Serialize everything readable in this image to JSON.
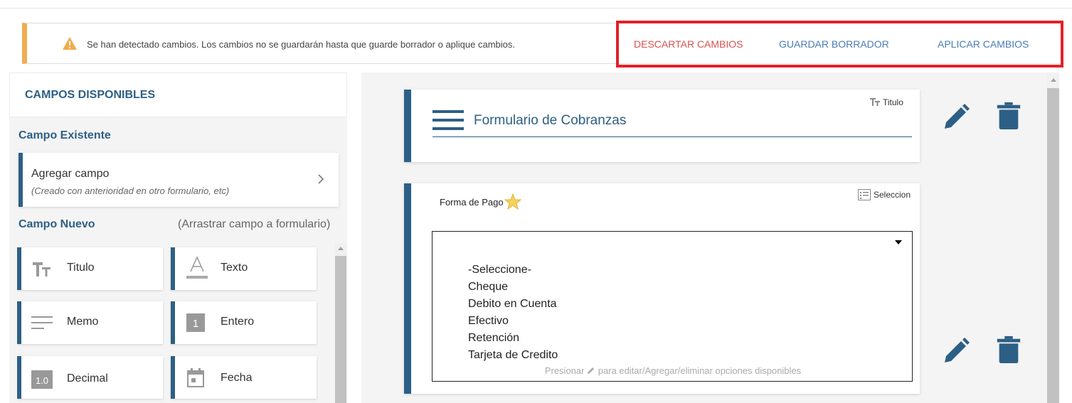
{
  "banner": {
    "message": "Se han detectado cambios. Los cambios no se guardarán hasta que guarde borrador o aplique cambios.",
    "discard": "DESCARTAR CAMBIOS",
    "save_draft": "GUARDAR BORRADOR",
    "apply": "APLICAR CAMBIOS"
  },
  "left_panel": {
    "title": "CAMPOS DISPONIBLES",
    "existing_section": "Campo Existente",
    "add_field": {
      "title": "Agregar campo",
      "subtitle": "(Creado con anterioridad en otro formulario, etc)"
    },
    "new_section": "Campo Nuevo",
    "drag_hint": "(Arrastrar campo a formulario)",
    "tiles": [
      {
        "label": "Titulo",
        "icon": "title-icon"
      },
      {
        "label": "Texto",
        "icon": "text-icon"
      },
      {
        "label": "Memo",
        "icon": "memo-icon"
      },
      {
        "label": "Entero",
        "icon": "integer-icon",
        "icon_text": "1"
      },
      {
        "label": "Decimal",
        "icon": "decimal-icon",
        "icon_text": "1.0"
      },
      {
        "label": "Fecha",
        "icon": "calendar-icon"
      }
    ]
  },
  "form": {
    "title_field": {
      "type_label": "Titulo",
      "value": "Formulario de Cobranzas"
    },
    "select_field": {
      "type_label": "Seleccion",
      "label": "Forma de Pago",
      "options": [
        "-Seleccione-",
        "Cheque",
        "Debito en Cuenta",
        "Efectivo",
        "Retención",
        "Tarjeta de Credito"
      ],
      "hint_before": "Presionar",
      "hint_after": "para editar/Agregar/eliminar opciones disponibles"
    }
  },
  "colors": {
    "primary": "#2d5f86",
    "warning": "#f0ad4e",
    "danger": "#d9534f",
    "link": "#4a7cb8",
    "highlight": "#e0212a"
  }
}
